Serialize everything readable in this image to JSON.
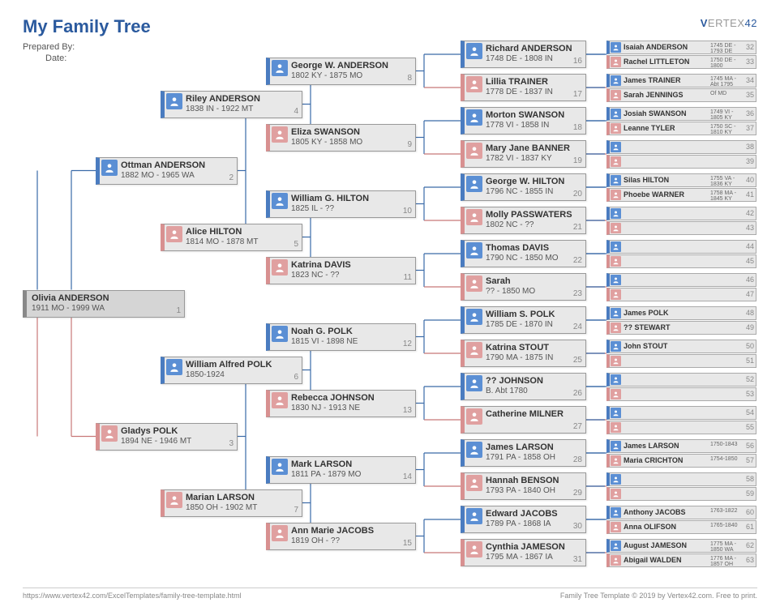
{
  "header": {
    "title": "My Family Tree",
    "preparedByLabel": "Prepared By:",
    "dateLabel": "Date:",
    "logo": "VERTEX42"
  },
  "footer": {
    "left": "https://www.vertex42.com/ExcelTemplates/family-tree-template.html",
    "right": "Family Tree Template © 2019 by Vertex42.com. Free to print."
  },
  "gen1": {
    "name": "Olivia ANDERSON",
    "dates": "1911 MO - 1999 WA",
    "num": "1"
  },
  "gen2": [
    {
      "name": "Ottman ANDERSON",
      "dates": "1882 MO - 1965 WA",
      "num": "2",
      "g": "m"
    },
    {
      "name": "Gladys POLK",
      "dates": "1894 NE - 1946 MT",
      "num": "3",
      "g": "f"
    }
  ],
  "gen3": [
    {
      "name": "Riley ANDERSON",
      "dates": "1838 IN - 1922 MT",
      "num": "4",
      "g": "m"
    },
    {
      "name": "Alice HILTON",
      "dates": "1814 MO - 1878 MT",
      "num": "5",
      "g": "f"
    },
    {
      "name": "William Alfred POLK",
      "dates": "1850-1924",
      "num": "6",
      "g": "m"
    },
    {
      "name": "Marian LARSON",
      "dates": "1850 OH - 1902 MT",
      "num": "7",
      "g": "f"
    }
  ],
  "gen4": [
    {
      "name": "George W. ANDERSON",
      "dates": "1802 KY - 1875 MO",
      "num": "8",
      "g": "m"
    },
    {
      "name": "Eliza SWANSON",
      "dates": "1805 KY - 1858 MO",
      "num": "9",
      "g": "f"
    },
    {
      "name": "William G. HILTON",
      "dates": "1825 IL - ??",
      "num": "10",
      "g": "m"
    },
    {
      "name": "Katrina DAVIS",
      "dates": "1823 NC - ??",
      "num": "11",
      "g": "f"
    },
    {
      "name": "Noah G. POLK",
      "dates": "1815 VI - 1898 NE",
      "num": "12",
      "g": "m"
    },
    {
      "name": "Rebecca JOHNSON",
      "dates": "1830 NJ - 1913 NE",
      "num": "13",
      "g": "f"
    },
    {
      "name": "Mark LARSON",
      "dates": "1811 PA - 1879 MO",
      "num": "14",
      "g": "m"
    },
    {
      "name": "Ann Marie JACOBS",
      "dates": "1819 OH - ??",
      "num": "15",
      "g": "f"
    }
  ],
  "gen5": [
    {
      "name": "Richard ANDERSON",
      "dates": "1748 DE - 1808 IN",
      "num": "16",
      "g": "m"
    },
    {
      "name": "Lillia TRAINER",
      "dates": "1778 DE - 1837 IN",
      "num": "17",
      "g": "f"
    },
    {
      "name": "Morton SWANSON",
      "dates": "1778 VI - 1858 IN",
      "num": "18",
      "g": "m"
    },
    {
      "name": "Mary Jane BANNER",
      "dates": "1782 VI - 1837 KY",
      "num": "19",
      "g": "f"
    },
    {
      "name": "George W. HILTON",
      "dates": "1796 NC - 1855 IN",
      "num": "20",
      "g": "m"
    },
    {
      "name": "Molly PASSWATERS",
      "dates": "1802 NC - ??",
      "num": "21",
      "g": "f"
    },
    {
      "name": "Thomas DAVIS",
      "dates": "1790 NC - 1850 MO",
      "num": "22",
      "g": "m"
    },
    {
      "name": "Sarah",
      "dates": "?? - 1850 MO",
      "num": "23",
      "g": "f"
    },
    {
      "name": "William S. POLK",
      "dates": "1785 DE - 1870 IN",
      "num": "24",
      "g": "m"
    },
    {
      "name": "Katrina STOUT",
      "dates": "1790 MA - 1875 IN",
      "num": "25",
      "g": "f"
    },
    {
      "name": "?? JOHNSON",
      "dates": "B. Abt 1780",
      "num": "26",
      "g": "m"
    },
    {
      "name": "Catherine MILNER",
      "dates": "",
      "num": "27",
      "g": "f"
    },
    {
      "name": "James LARSON",
      "dates": "1791 PA - 1858 OH",
      "num": "28",
      "g": "m"
    },
    {
      "name": "Hannah BENSON",
      "dates": "1793 PA - 1840 OH",
      "num": "29",
      "g": "f"
    },
    {
      "name": "Edward JACOBS",
      "dates": "1789 PA - 1868 IA",
      "num": "30",
      "g": "m"
    },
    {
      "name": "Cynthia JAMESON",
      "dates": "1795 MA - 1867 IA",
      "num": "31",
      "g": "f"
    }
  ],
  "gen6": [
    {
      "name": "Isaiah ANDERSON",
      "dates": "1745 DE - 1793 DE",
      "num": "32",
      "g": "m"
    },
    {
      "name": "Rachel LITTLETON",
      "dates": "1750 DE - 1800",
      "num": "33",
      "g": "f"
    },
    {
      "name": "James TRAINER",
      "dates": "1745 MA - Abt 1795",
      "num": "34",
      "g": "m"
    },
    {
      "name": "Sarah JENNINGS",
      "dates": "Of MD",
      "num": "35",
      "g": "f"
    },
    {
      "name": "Josiah SWANSON",
      "dates": "1749 VI - 1805 KY",
      "num": "36",
      "g": "m"
    },
    {
      "name": "Leanne TYLER",
      "dates": "1750 SC - 1810 KY",
      "num": "37",
      "g": "f"
    },
    {
      "name": "",
      "dates": "",
      "num": "38",
      "g": "m"
    },
    {
      "name": "",
      "dates": "",
      "num": "39",
      "g": "f"
    },
    {
      "name": "Silas HILTON",
      "dates": "1755 VA - 1836 KY",
      "num": "40",
      "g": "m"
    },
    {
      "name": "Phoebe WARNER",
      "dates": "1758 MA - 1845 KY",
      "num": "41",
      "g": "f"
    },
    {
      "name": "",
      "dates": "",
      "num": "42",
      "g": "m"
    },
    {
      "name": "",
      "dates": "",
      "num": "43",
      "g": "f"
    },
    {
      "name": "",
      "dates": "",
      "num": "44",
      "g": "m"
    },
    {
      "name": "",
      "dates": "",
      "num": "45",
      "g": "f"
    },
    {
      "name": "",
      "dates": "",
      "num": "46",
      "g": "m"
    },
    {
      "name": "",
      "dates": "",
      "num": "47",
      "g": "f"
    },
    {
      "name": "James POLK",
      "dates": "",
      "num": "48",
      "g": "m"
    },
    {
      "name": "?? STEWART",
      "dates": "",
      "num": "49",
      "g": "f"
    },
    {
      "name": "John STOUT",
      "dates": "",
      "num": "50",
      "g": "m"
    },
    {
      "name": "",
      "dates": "",
      "num": "51",
      "g": "f"
    },
    {
      "name": "",
      "dates": "",
      "num": "52",
      "g": "m"
    },
    {
      "name": "",
      "dates": "",
      "num": "53",
      "g": "f"
    },
    {
      "name": "",
      "dates": "",
      "num": "54",
      "g": "m"
    },
    {
      "name": "",
      "dates": "",
      "num": "55",
      "g": "f"
    },
    {
      "name": "James LARSON",
      "dates": "1750-1843",
      "num": "56",
      "g": "m"
    },
    {
      "name": "Maria CRICHTON",
      "dates": "1754-1850",
      "num": "57",
      "g": "f"
    },
    {
      "name": "",
      "dates": "",
      "num": "58",
      "g": "m"
    },
    {
      "name": "",
      "dates": "",
      "num": "59",
      "g": "f"
    },
    {
      "name": "Anthony JACOBS",
      "dates": "1763-1822",
      "num": "60",
      "g": "m"
    },
    {
      "name": "Anna OLIFSON",
      "dates": "1765-1840",
      "num": "61",
      "g": "f"
    },
    {
      "name": "August JAMESON",
      "dates": "1775 MA - 1850 WA",
      "num": "62",
      "g": "m"
    },
    {
      "name": "Abigail WALDEN",
      "dates": "1776 MA - 1857 OH",
      "num": "63",
      "g": "f"
    }
  ]
}
